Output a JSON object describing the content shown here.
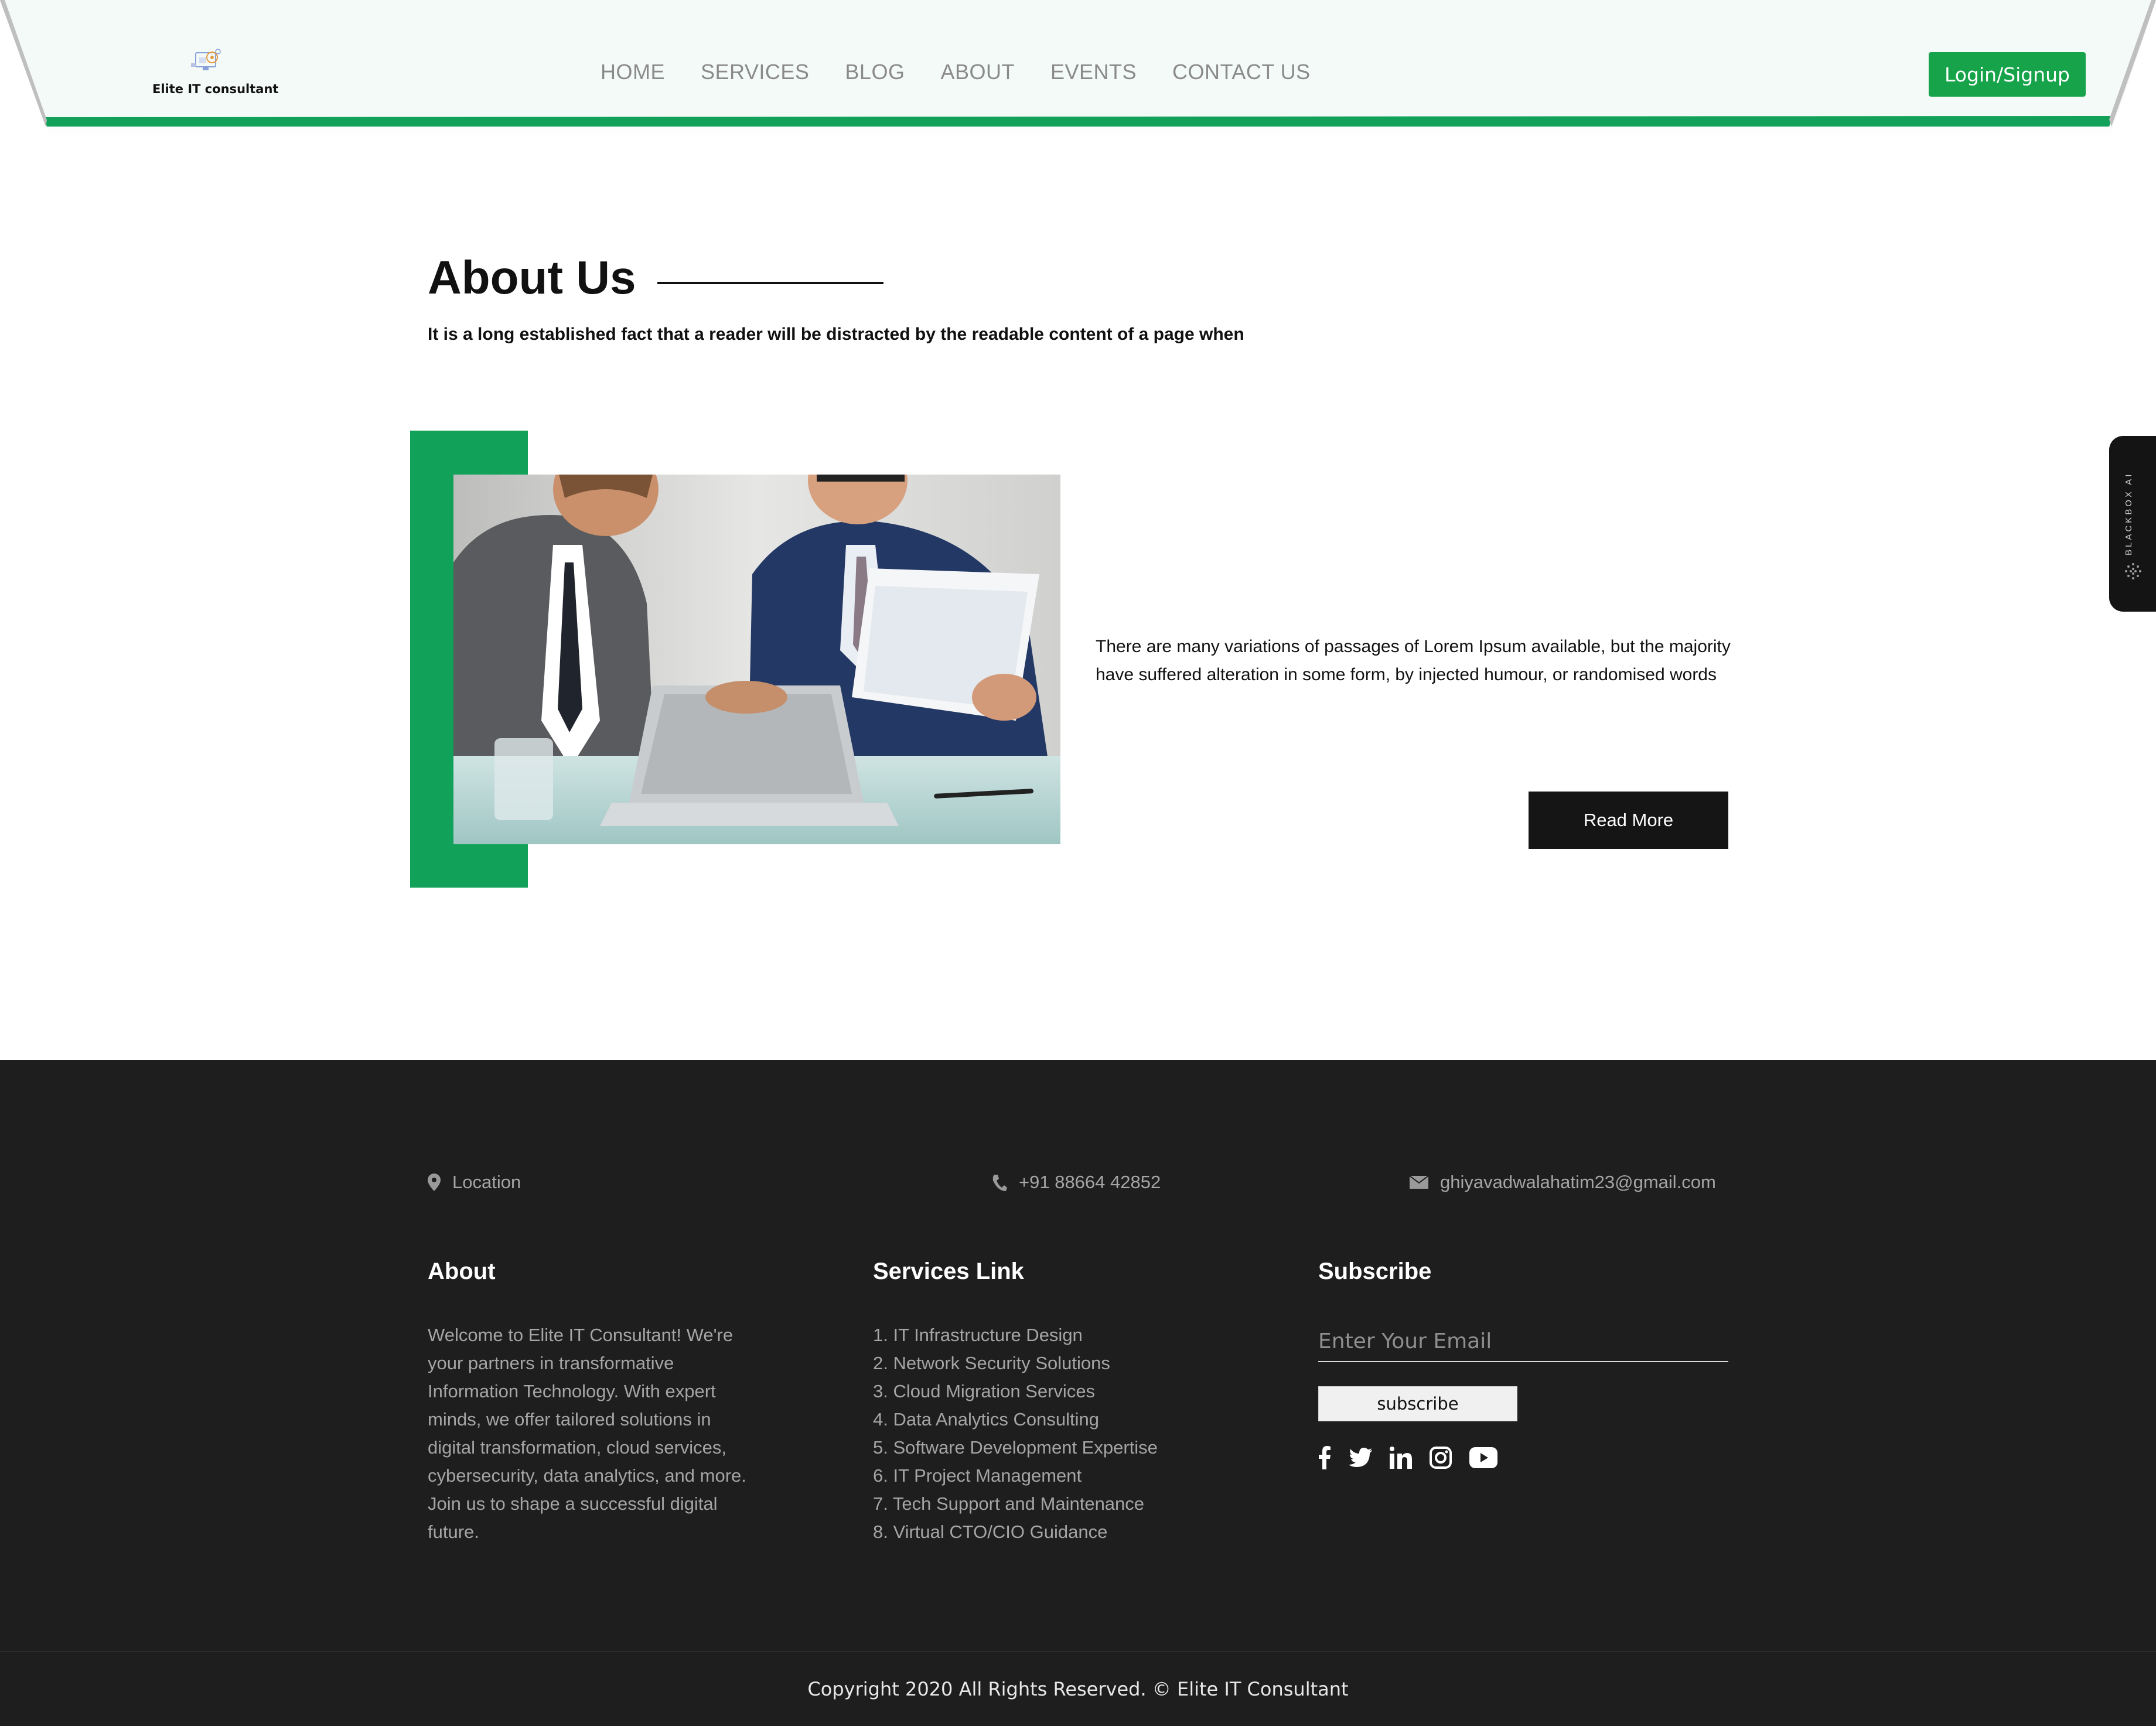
{
  "header": {
    "logo_text": "Elite IT consultant",
    "nav": [
      "HOME",
      "SERVICES",
      "BLOG",
      "ABOUT",
      "EVENTS",
      "CONTACT US"
    ],
    "login_label": "Login/Signup"
  },
  "about": {
    "title": "About Us",
    "subtitle": "It is a long established fact that a reader will be distracted by the readable content of a page when",
    "body": "There are many variations of passages of Lorem Ipsum available, but the majority have suffered alteration in some form, by injected humour, or randomised words",
    "read_more": "Read More"
  },
  "side_tab": {
    "label": "BLACKBOX AI"
  },
  "footer": {
    "location": "Location",
    "phone": "+91 88664 42852",
    "email": "ghiyavadwalahatim23@gmail.com",
    "about_heading": "About",
    "about_text": "Welcome to Elite IT Consultant! We're your partners in transformative Information Technology. With expert minds, we offer tailored solutions in digital transformation, cloud services, cybersecurity, data analytics, and more. Join us to shape a successful digital future.",
    "services_heading": "Services Link",
    "services": [
      "1. IT Infrastructure Design",
      "2. Network Security Solutions",
      "3. Cloud Migration Services",
      "4. Data Analytics Consulting",
      "5. Software Development Expertise",
      "6. IT Project Management",
      "7. Tech Support and Maintenance",
      "8. Virtual CTO/CIO Guidance"
    ],
    "subscribe_heading": "Subscribe",
    "email_placeholder": "Enter Your Email",
    "subscribe_label": "subscribe",
    "socials": [
      "facebook-icon",
      "twitter-icon",
      "linkedin-icon",
      "instagram-icon",
      "youtube-icon"
    ],
    "copyright": "Copyright 2020 All Rights Reserved. © Elite IT Consultant"
  },
  "colors": {
    "accent": "#12a159",
    "button_green": "#16a34a",
    "footer_bg": "#1e1e1e",
    "dark_button": "#151515"
  }
}
